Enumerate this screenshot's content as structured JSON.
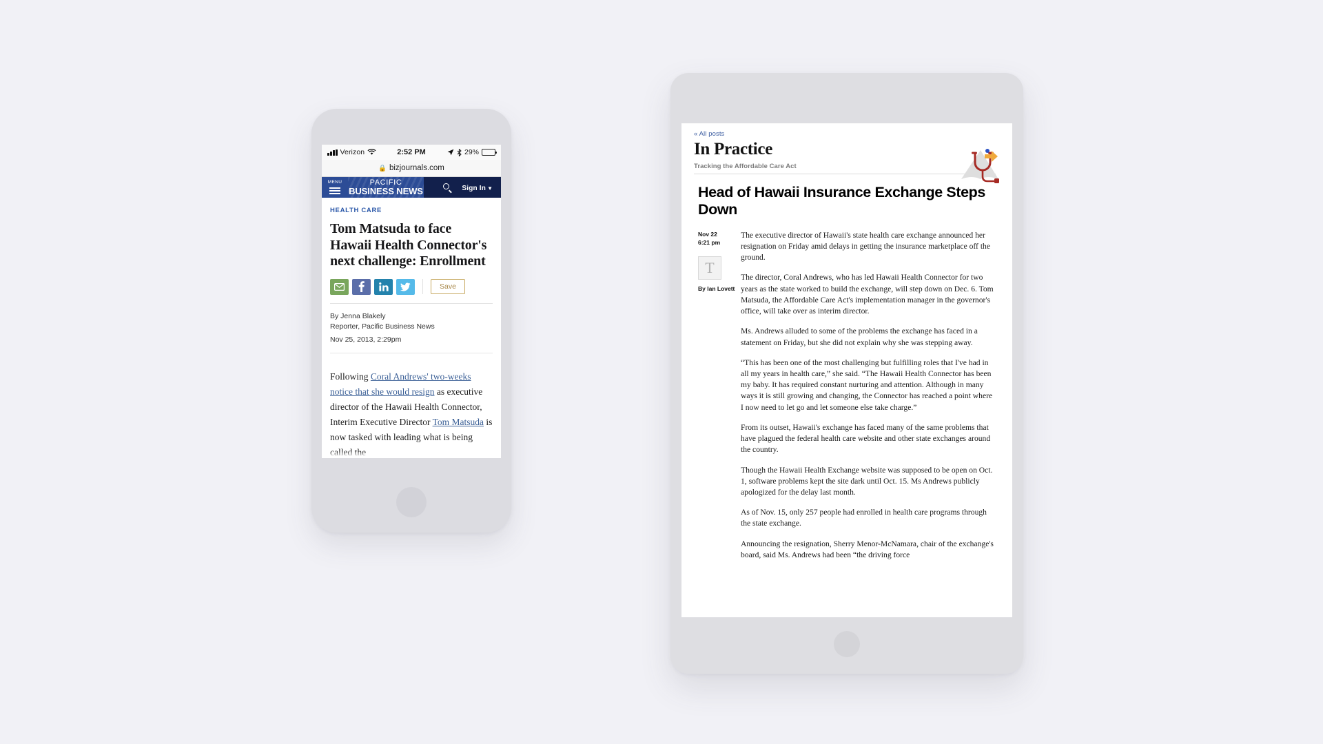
{
  "colors": {
    "page_bg": "#f1f1f6",
    "device_body": "#dcdce1",
    "pbn_nav_dark": "#12204c",
    "pbn_nav_blue": "#2c4c96",
    "kicker_blue": "#2a57a8",
    "link_blue": "#3a5f96",
    "save_gold": "#c6a85f",
    "email_green": "#79a65c",
    "facebook_blue": "#5b6ea9",
    "linkedin_blue": "#2382ac",
    "twitter_blue": "#55bae9",
    "stethoscope_red": "#a62b25",
    "arrow_orange": "#f0a93c"
  },
  "phone": {
    "status_bar": {
      "signal_icon": "signal-bars-icon",
      "carrier": "Verizon",
      "wifi_icon": "wifi-icon",
      "time": "2:52 PM",
      "location_icon": "location-arrow-icon",
      "bluetooth_icon": "bluetooth-icon",
      "battery_percent": "29%",
      "battery_icon": "battery-icon",
      "battery_level": 29
    },
    "browser": {
      "lock_icon": "lock-icon",
      "url": "bizjournals.com"
    },
    "nav": {
      "menu_label": "MENU",
      "hamburger_icon": "hamburger-icon",
      "logo_line1": "PACIFIC",
      "logo_line2": "BUSINESS NEWS",
      "search_icon": "search-icon",
      "signin_label": "Sign In",
      "chevron_icon": "chevron-down-icon"
    },
    "article": {
      "kicker": "HEALTH CARE",
      "headline": "Tom Matsuda to face Hawaii Health Connector's next challenge: Enrollment",
      "share_buttons": [
        {
          "name": "email-share-button",
          "icon": "envelope-icon",
          "label": "Email"
        },
        {
          "name": "facebook-share-button",
          "icon": "facebook-icon",
          "label": "Facebook"
        },
        {
          "name": "linkedin-share-button",
          "icon": "linkedin-icon",
          "label": "LinkedIn"
        },
        {
          "name": "twitter-share-button",
          "icon": "twitter-icon",
          "label": "Twitter"
        }
      ],
      "save_label": "Save",
      "author": "By Jenna Blakely",
      "author_title": "Reporter, Pacific Business News",
      "published": "Nov 25, 2013, 2:29pm",
      "body_prefix": "Following ",
      "body_link1": "Coral Andrews' two-weeks notice that she would resign",
      "body_mid": " as executive director of the Hawaii Health Connector, Interim Executive Director ",
      "body_link2": "Tom Matsuda",
      "body_suffix": " is now tasked with leading what is being called the"
    }
  },
  "tablet": {
    "blog": {
      "back_link": "« All posts",
      "title": "In Practice",
      "tagline": "Tracking the Affordable Care Act",
      "logo_icon": "stethoscope-logo-icon"
    },
    "article": {
      "headline": "Head of Hawaii Insurance Exchange Steps Down",
      "date": "Nov 22",
      "time": "6:21 pm",
      "publisher_icon": "nyt-t-logo-icon",
      "author": "By Ian Lovett",
      "paragraphs": [
        "The executive director of Hawaii's state health care exchange announced her resignation on Friday amid delays in getting the insurance marketplace off the ground.",
        "The director, Coral Andrews, who has led Hawaii Health Connector for two years as the state worked to build the exchange, will step down on Dec. 6. Tom Matsuda, the Affordable Care Act's implementation manager in the governor's office, will take over as interim director.",
        "Ms. Andrews alluded to some of the problems the exchange has faced in a statement on Friday, but she did not explain why she was stepping away.",
        "“This has been one of the most challenging but fulfilling roles that I've had in all my years in health care,” she said. “The Hawaii Health Connector has been my baby. It has required constant nurturing and attention. Although in many ways it is still growing and changing, the Connector has reached a point where I now need to let go and let someone else take charge.”",
        "From its outset, Hawaii's exchange has faced many of the same problems that have plagued the federal health care website and other state exchanges around the country.",
        "Though the Hawaii Health Exchange website was supposed to be open on Oct. 1, software problems kept the site dark until Oct. 15. Ms Andrews publicly apologized for the delay last month.",
        "As of Nov. 15, only 257 people had enrolled in health care programs through the state exchange.",
        "Announcing the resignation, Sherry Menor-McNamara, chair of the exchange's board, said Ms. Andrews had been “the driving force"
      ]
    }
  }
}
